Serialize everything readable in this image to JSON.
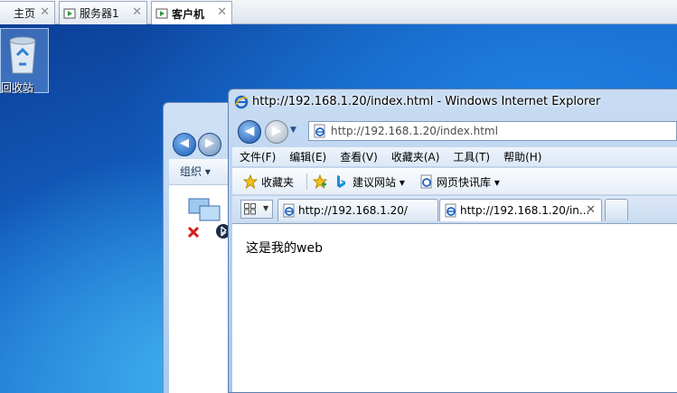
{
  "vm_tabs": [
    {
      "label": "主页",
      "close": "✕"
    },
    {
      "label": "服务器1",
      "close": "✕"
    },
    {
      "label": "客户机",
      "close": "✕"
    }
  ],
  "desktop": {
    "recycle_label": "回收站"
  },
  "explorer": {
    "back_glyph": "◀",
    "forward_glyph": "▶",
    "toolbar_label": "组织 ▾"
  },
  "ie": {
    "title": "http://192.168.1.20/index.html - Windows Internet Explorer",
    "back_glyph": "◀",
    "forward_glyph": "▶",
    "nav_dropdown": "▼",
    "address": "http://192.168.1.20/index.html",
    "menu": [
      "文件(F)",
      "编辑(E)",
      "查看(V)",
      "收藏夹(A)",
      "工具(T)",
      "帮助(H)"
    ],
    "favorites_bar": {
      "favorites_label": "收藏夹",
      "suggested_sites": "建议网站 ▾",
      "web_slice": "网页快讯库 ▾"
    },
    "tabs": [
      {
        "label": "http://192.168.1.20/"
      },
      {
        "label": "http://192.168.1.20/in...",
        "close": "✕"
      }
    ],
    "page_content": "这是我的web"
  },
  "colors": {
    "ie_blue": "#1f64c4",
    "desktop_blue": "#1565c8",
    "vm_tab_green": "#2e9a3c"
  }
}
